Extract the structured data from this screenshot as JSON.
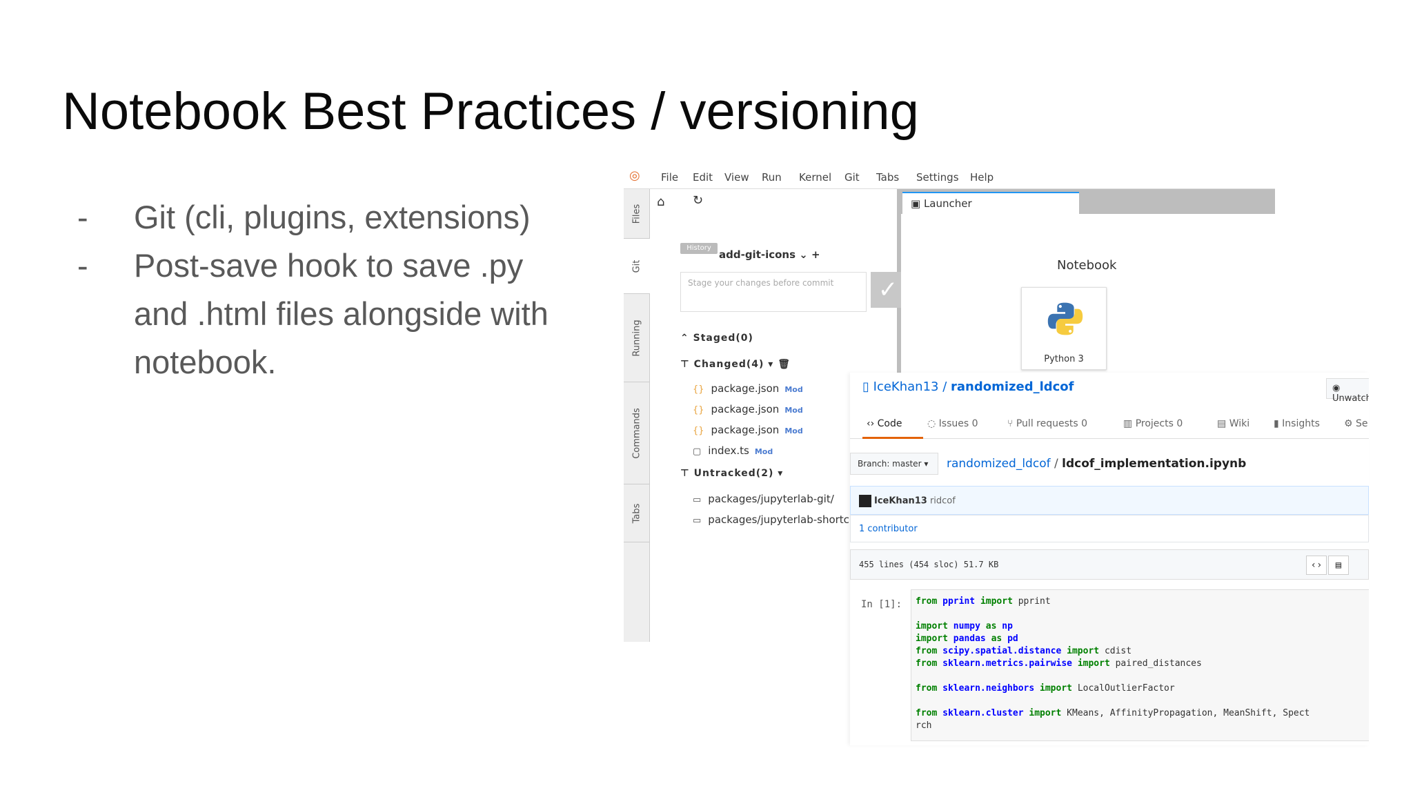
{
  "slide": {
    "title": "Notebook Best Practices / versioning",
    "bullets": [
      {
        "dash": "-",
        "text": "Git (cli, plugins, extensions)"
      },
      {
        "dash": "-",
        "text": "Post-save hook to save .py and .html files alongside with notebook."
      }
    ]
  },
  "jupyterlab": {
    "menu": [
      "File",
      "Edit",
      "View",
      "Run",
      "Kernel",
      "Git",
      "Tabs",
      "Settings",
      "Help"
    ],
    "side_tabs": [
      "Files",
      "Git",
      "Running",
      "Commands",
      "Tabs"
    ],
    "git_panel": {
      "history_tag": "History",
      "branch": "add-git-icons ⌄ +",
      "commit_placeholder": "Stage your changes before commit",
      "staged": "Staged(0)",
      "changed": "Changed(4)",
      "untracked": "Untracked(2)",
      "changed_files": [
        {
          "name": "package.json",
          "status": "Mod"
        },
        {
          "name": "package.json",
          "status": "Mod"
        },
        {
          "name": "package.json",
          "status": "Mod"
        },
        {
          "name": "index.ts",
          "status": "Mod"
        }
      ],
      "untracked_files": [
        "packages/jupyterlab-git/",
        "packages/jupyterlab-shortcuts"
      ]
    },
    "launcher": {
      "tab": "Launcher",
      "heading": "Notebook",
      "card_label": "Python 3"
    }
  },
  "github": {
    "owner": "IceKhan13",
    "repo": "randomized_ldcof",
    "unwatch": "Unwatch",
    "tabs": [
      {
        "label": "Code"
      },
      {
        "label": "Issues 0"
      },
      {
        "label": "Pull requests 0"
      },
      {
        "label": "Projects 0"
      },
      {
        "label": "Wiki"
      },
      {
        "label": "Insights"
      },
      {
        "label": "Se"
      }
    ],
    "branch": "Branch: master ▾",
    "path_repo": "randomized_ldcof",
    "path_sep": " / ",
    "path_file": "ldcof_implementation.ipynb",
    "commit_user": "IceKhan13",
    "commit_msg": "ridcof",
    "contributors": "1 contributor",
    "file_info": "455 lines (454 sloc)   51.7 KB",
    "prompt": "In [1]:",
    "code": {
      "l1a": "from",
      "l1b": "pprint",
      "l1c": "import",
      "l1d": "pprint",
      "l2a": "import",
      "l2b": "numpy",
      "l2c": "as",
      "l2d": "np",
      "l3a": "import",
      "l3b": "pandas",
      "l3c": "as",
      "l3d": "pd",
      "l4a": "from",
      "l4b": "scipy.spatial.distance",
      "l4c": "import",
      "l4d": "cdist",
      "l5a": "from",
      "l5b": "sklearn.metrics.pairwise",
      "l5c": "import",
      "l5d": "paired_distances",
      "l6a": "from",
      "l6b": "sklearn.neighbors",
      "l6c": "import",
      "l6d": "LocalOutlierFactor",
      "l7a": "from",
      "l7b": "sklearn.cluster",
      "l7c": "import",
      "l7d": "KMeans, AffinityPropagation, MeanShift, Spect",
      "l8": "rch"
    }
  }
}
